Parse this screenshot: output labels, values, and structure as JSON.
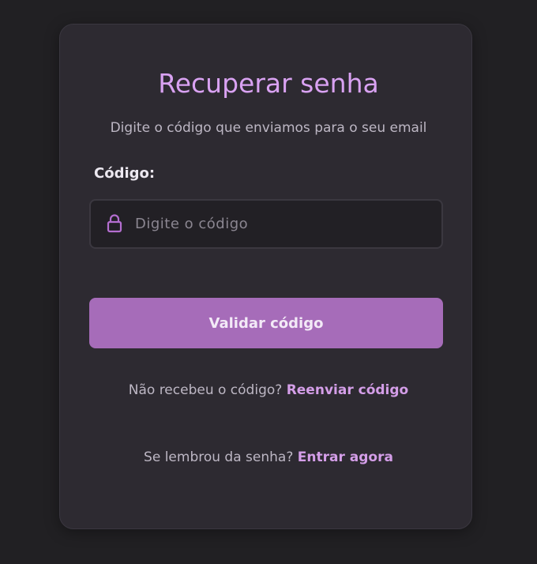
{
  "page": {
    "title": "Recuperar senha",
    "subtitle": "Digite o código que enviamos para o seu email"
  },
  "form": {
    "code_label": "Código:",
    "code_placeholder": "Digite o código",
    "code_value": "",
    "submit_label": "Validar código",
    "lock_icon": "lock-icon"
  },
  "resend": {
    "prompt": "Não recebeu o código?",
    "link": "Reenviar código"
  },
  "login": {
    "prompt": "Se lembrou da senha?",
    "link": "Entrar agora"
  },
  "colors": {
    "background": "#212023",
    "card": "#2d2a31",
    "accent": "#d9a2f2",
    "button": "#a66cb9"
  }
}
